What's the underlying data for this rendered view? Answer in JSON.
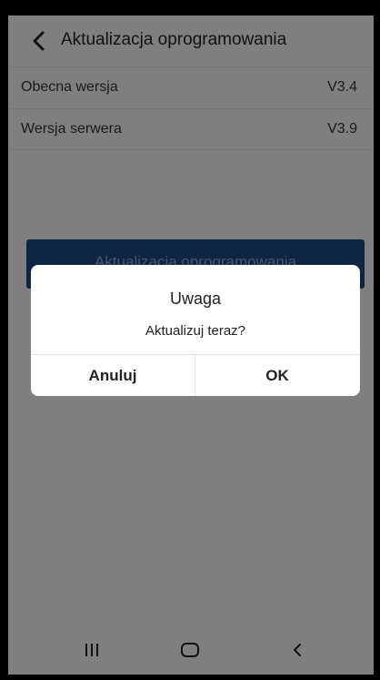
{
  "header": {
    "title": "Aktualizacja oprogramowania",
    "back_icon": "chevron-left-icon"
  },
  "info": {
    "rows": [
      {
        "label": "Obecna wersja",
        "value": "V3.4"
      },
      {
        "label": "Wersja serwera",
        "value": "V3.9"
      }
    ]
  },
  "update_button": {
    "label": "Aktualizacja oprogramowania"
  },
  "dialog": {
    "title": "Uwaga",
    "message": "Aktualizuj teraz?",
    "cancel_label": "Anuluj",
    "ok_label": "OK"
  },
  "navbar": {
    "items": [
      "recent-apps-icon",
      "home-icon",
      "back-icon"
    ]
  },
  "colors": {
    "overlay_background": "#7f7f7f",
    "button_dimmed": "#0f2544",
    "dialog_background": "#ffffff"
  }
}
